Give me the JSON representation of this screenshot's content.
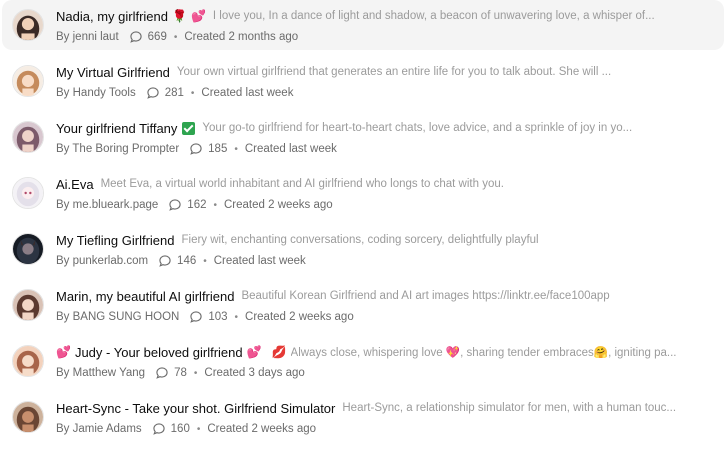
{
  "items": [
    {
      "name": "Nadia, my girlfriend",
      "title_emojis": [
        "🌹",
        "💕"
      ],
      "verified": false,
      "description": "I love you, In a dance of light and shadow, a beacon of unwavering love, a whisper of...",
      "author": "By jenni laut",
      "chats": "669",
      "created": "Created 2 months ago",
      "avatar_color": "#3a2a26"
    },
    {
      "name": "My Virtual Girlfriend",
      "title_emojis": [],
      "verified": false,
      "description": "Your own virtual girlfriend that generates an entire life for you to talk about. She will ...",
      "author": "By Handy Tools",
      "chats": "281",
      "created": "Created last week",
      "avatar_color": "#c58b5c"
    },
    {
      "name": "Your girlfriend Tiffany",
      "title_emojis": [],
      "verified": true,
      "description": "Your go-to girlfriend for heart-to-heart chats, love advice, and a sprinkle of joy in yo...",
      "author": "By The Boring Prompter",
      "chats": "185",
      "created": "Created last week",
      "avatar_color": "#7c5a6a"
    },
    {
      "name": "Ai.Eva",
      "title_emojis": [],
      "verified": false,
      "description": "Meet Eva, a virtual world inhabitant and AI girlfriend who longs to chat with you.",
      "author": "By me.blueark.page",
      "chats": "162",
      "created": "Created 2 weeks ago",
      "avatar_color": "#d9d6de"
    },
    {
      "name": "My Tiefling Girlfriend",
      "title_emojis": [],
      "verified": false,
      "description": "Fiery wit, enchanting conversations, coding sorcery, delightfully playful",
      "author": "By punkerlab.com",
      "chats": "146",
      "created": "Created last week",
      "avatar_color": "#1f2633"
    },
    {
      "name": "Marin, my beautiful AI girlfriend",
      "title_emojis": [],
      "verified": false,
      "description": "Beautiful Korean Girlfriend and AI art images https://linktr.ee/face100app",
      "author": "By BANG SUNG HOON",
      "chats": "103",
      "created": "Created 2 weeks ago",
      "avatar_color": "#5b3a30"
    },
    {
      "name": "Judy - Your beloved girlfriend",
      "title_emojis": [
        "💕"
      ],
      "lead_emoji": "💕",
      "verified": false,
      "desc_emoji": "💋",
      "description": "Always close, whispering love 💖, sharing tender embraces🤗, igniting pa...",
      "author": "By Matthew Yang",
      "chats": "78",
      "created": "Created 3 days ago",
      "avatar_color": "#a8654a"
    },
    {
      "name": "Heart-Sync - Take your shot. Girlfriend Simulator",
      "title_emojis": [],
      "verified": false,
      "description": "Heart-Sync, a relationship simulator for men, with a human touc...",
      "author": "By Jamie Adams",
      "chats": "160",
      "created": "Created 2 weeks ago",
      "avatar_color": "#6a4634"
    }
  ]
}
